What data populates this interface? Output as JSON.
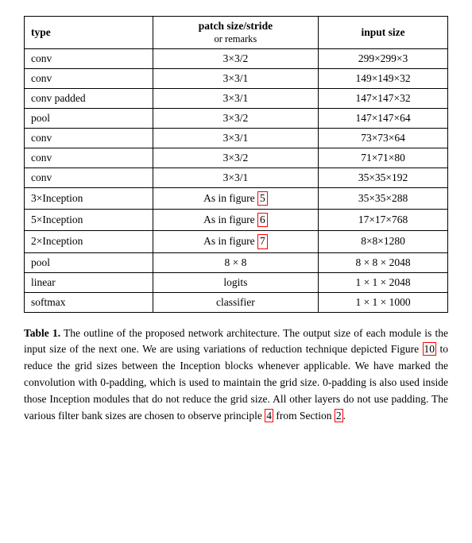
{
  "table": {
    "headers": {
      "col1": "type",
      "col2_main": "patch size/stride",
      "col2_sub": "or remarks",
      "col3": "input size"
    },
    "rows": [
      {
        "type": "conv",
        "patch": "3×3/2",
        "input": "299×299×3"
      },
      {
        "type": "conv",
        "patch": "3×3/1",
        "input": "149×149×32"
      },
      {
        "type": "conv padded",
        "patch": "3×3/1",
        "input": "147×147×32"
      },
      {
        "type": "pool",
        "patch": "3×3/2",
        "input": "147×147×64"
      },
      {
        "type": "conv",
        "patch": "3×3/1",
        "input": "73×73×64"
      },
      {
        "type": "conv",
        "patch": "3×3/2",
        "input": "71×71×80"
      },
      {
        "type": "conv",
        "patch": "3×3/1",
        "input": "35×35×192"
      },
      {
        "type": "3×Inception",
        "patch": "As in figure 5",
        "input": "35×35×288",
        "patch_ref": "5"
      },
      {
        "type": "5×Inception",
        "patch": "As in figure 6",
        "input": "17×17×768",
        "patch_ref": "6"
      },
      {
        "type": "2×Inception",
        "patch": "As in figure 7",
        "input": "8×8×1280",
        "patch_ref": "7"
      },
      {
        "type": "pool",
        "patch": "8 × 8",
        "input": "8 × 8 × 2048"
      },
      {
        "type": "linear",
        "patch": "logits",
        "input": "1 × 1 × 2048"
      },
      {
        "type": "softmax",
        "patch": "classifier",
        "input": "1 × 1 × 1000"
      }
    ]
  },
  "caption": {
    "label": "Table 1.",
    "text": " The outline of the proposed network architecture.  The output size of each module is the input size of the next one.  We are using variations of reduction technique depicted Figure ",
    "ref1": "10",
    "text2": " to reduce the grid sizes between the Inception blocks whenever applicable.  We have marked the convolution with 0-padding, which is used to maintain the grid size.  0-padding is also used inside those Inception modules that do not reduce the grid size.  All other layers do not use padding.  The various filter bank sizes are chosen to observe principle ",
    "ref2": "4",
    "text3": " from Section ",
    "ref3": "2",
    "text4": "."
  }
}
